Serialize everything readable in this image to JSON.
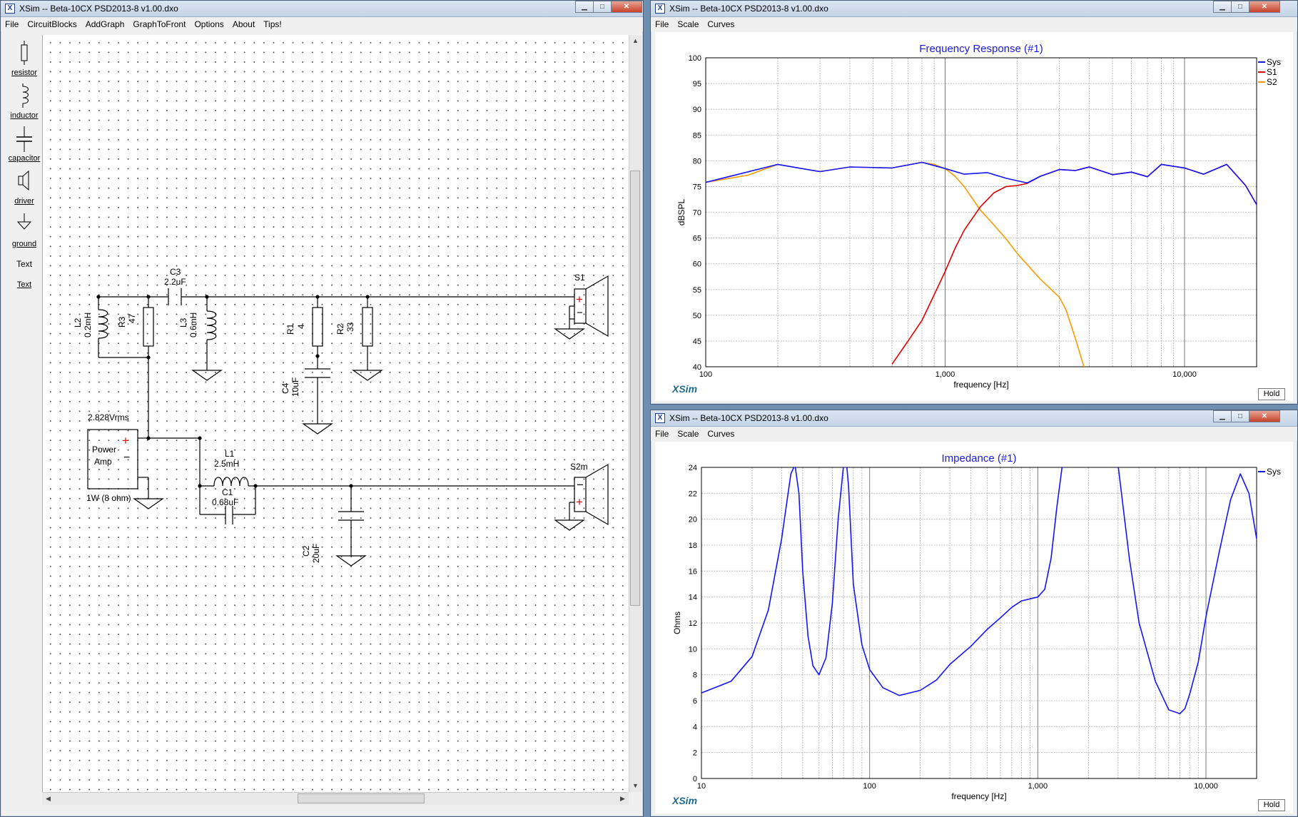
{
  "schematic_window": {
    "title": "XSim -- Beta-10CX PSD2013-8 v1.00.dxo",
    "menu": [
      "File",
      "CircuitBlocks",
      "AddGraph",
      "GraphToFront",
      "Options",
      "About",
      "Tips!"
    ],
    "tools": [
      {
        "icon": "resistor-icon",
        "label": "resistor"
      },
      {
        "icon": "inductor-icon",
        "label": "inductor"
      },
      {
        "icon": "capacitor-icon",
        "label": "capacitor"
      },
      {
        "icon": "driver-icon",
        "label": "driver"
      },
      {
        "icon": "ground-icon",
        "label": "ground"
      },
      {
        "icon": "text-icon",
        "label": "Text"
      },
      {
        "icon": "text-tool-icon",
        "label": "Text"
      }
    ],
    "components": {
      "C3": {
        "name": "C3",
        "value": "2.2uF"
      },
      "L2": {
        "name": "L2",
        "value": "0.2mH"
      },
      "R3": {
        "name": "R3",
        "value": "47"
      },
      "L3": {
        "name": "L3",
        "value": "0.6mH"
      },
      "R1": {
        "name": "R1",
        "value": "4"
      },
      "R2": {
        "name": "R2",
        "value": "33"
      },
      "C4": {
        "name": "C4",
        "value": "10uF"
      },
      "L1": {
        "name": "L1",
        "value": "2.5mH"
      },
      "C1": {
        "name": "C1",
        "value": "0.68uF"
      },
      "C2": {
        "name": "C2",
        "value": "20uF"
      },
      "S1": {
        "name": "S1"
      },
      "S2m": {
        "name": "S2m"
      },
      "amp": {
        "voltage": "2.828Vrms",
        "line1": "Power",
        "line2": "Amp",
        "power": "1W (8 ohm)"
      }
    }
  },
  "fr_window": {
    "title": "XSim -- Beta-10CX PSD2013-8 v1.00.dxo",
    "menu": [
      "File",
      "Scale",
      "Curves"
    ],
    "brand": "XSim",
    "hold_label": "Hold"
  },
  "imp_window": {
    "title": "XSim -- Beta-10CX PSD2013-8 v1.00.dxo",
    "menu": [
      "File",
      "Scale",
      "Curves"
    ],
    "brand": "XSim",
    "hold_label": "Hold"
  },
  "chart_data": [
    {
      "type": "line",
      "title": "Frequency Response (#1)",
      "xlabel": "frequency [Hz]",
      "ylabel": "dBSPL",
      "x_scale": "log",
      "xlim": [
        100,
        20000
      ],
      "ylim": [
        40,
        100
      ],
      "x_ticks": [
        100,
        1000,
        10000
      ],
      "x_tick_labels": [
        "100",
        "1,000",
        "10,000"
      ],
      "y_ticks": [
        40,
        45,
        50,
        55,
        60,
        65,
        70,
        75,
        80,
        85,
        90,
        95,
        100
      ],
      "grid": true,
      "legend_position": "top-right",
      "series": [
        {
          "name": "Sys",
          "color": "#1414ff",
          "x": [
            100,
            200,
            300,
            400,
            600,
            800,
            1000,
            1200,
            1500,
            1800,
            2200,
            2500,
            3000,
            3500,
            4000,
            5000,
            6000,
            7000,
            8000,
            10000,
            12000,
            15000,
            18000,
            20000
          ],
          "y": [
            75.8,
            79.3,
            77.9,
            78.8,
            78.6,
            79.7,
            78.5,
            77.4,
            77.7,
            76.6,
            75.7,
            77.0,
            78.3,
            78.1,
            78.8,
            77.3,
            77.8,
            76.9,
            79.3,
            78.6,
            77.4,
            79.3,
            75.2,
            71.5
          ]
        },
        {
          "name": "S1",
          "color": "#e60000",
          "x": [
            600,
            700,
            800,
            900,
            1000,
            1100,
            1200,
            1400,
            1600,
            1800,
            2000,
            2200,
            2500,
            3000,
            3500,
            4000,
            5000,
            6000,
            7000,
            8000,
            10000,
            12000,
            15000,
            18000,
            20000
          ],
          "y": [
            40.5,
            45.0,
            49.0,
            54.0,
            58.5,
            63.0,
            66.5,
            71.0,
            73.8,
            75.0,
            75.2,
            75.6,
            77.0,
            78.3,
            78.1,
            78.8,
            77.3,
            77.8,
            76.9,
            79.3,
            78.6,
            77.4,
            79.3,
            75.2,
            71.5
          ]
        },
        {
          "name": "S2",
          "color": "#ff9900",
          "x": [
            100,
            150,
            200,
            300,
            400,
            600,
            800,
            900,
            1000,
            1100,
            1200,
            1400,
            1600,
            1800,
            2000,
            2500,
            3000,
            3200,
            3500,
            3800
          ],
          "y": [
            75.8,
            77.2,
            79.3,
            77.9,
            78.8,
            78.6,
            79.7,
            79.3,
            78.5,
            77.0,
            75.0,
            70.5,
            67.5,
            64.8,
            62.0,
            57.0,
            53.5,
            51.0,
            45.5,
            40.0
          ]
        }
      ]
    },
    {
      "type": "line",
      "title": "Impedance (#1)",
      "xlabel": "frequency [Hz]",
      "ylabel": "Ohms",
      "x_scale": "log",
      "xlim": [
        10,
        20000
      ],
      "ylim": [
        0,
        24
      ],
      "x_ticks": [
        10,
        100,
        1000,
        10000
      ],
      "x_tick_labels": [
        "10",
        "100",
        "1,000",
        "10,000"
      ],
      "y_ticks": [
        0,
        2,
        4,
        6,
        8,
        10,
        12,
        14,
        16,
        18,
        20,
        22,
        24
      ],
      "grid": true,
      "legend_position": "top-right",
      "series": [
        {
          "name": "Sys",
          "color": "#1414ff",
          "x": [
            10,
            15,
            20,
            25,
            30,
            34,
            36,
            38,
            40,
            43,
            46,
            50,
            55,
            60,
            65,
            70,
            73,
            75,
            80,
            90,
            100,
            120,
            150,
            200,
            250,
            300,
            400,
            500,
            600,
            700,
            800,
            1000,
            1100,
            1200,
            1300,
            1400,
            3000,
            3500,
            4000,
            5000,
            6000,
            7000,
            7500,
            8000,
            9000,
            10000,
            12000,
            14000,
            16000,
            18000,
            20000
          ],
          "y": [
            6.6,
            7.5,
            9.4,
            13.0,
            18.5,
            23.5,
            24.2,
            22.0,
            16.0,
            11.0,
            8.7,
            8.0,
            9.3,
            13.5,
            20.0,
            24.2,
            24.2,
            22.5,
            15.0,
            10.3,
            8.4,
            7.0,
            6.4,
            6.8,
            7.6,
            8.8,
            10.2,
            11.5,
            12.4,
            13.2,
            13.7,
            14.0,
            14.6,
            17.0,
            21.0,
            24.2,
            24.2,
            17.0,
            12.0,
            7.5,
            5.3,
            5.0,
            5.4,
            6.5,
            9.0,
            12.5,
            17.5,
            21.5,
            23.5,
            22.0,
            18.5
          ]
        }
      ]
    }
  ]
}
